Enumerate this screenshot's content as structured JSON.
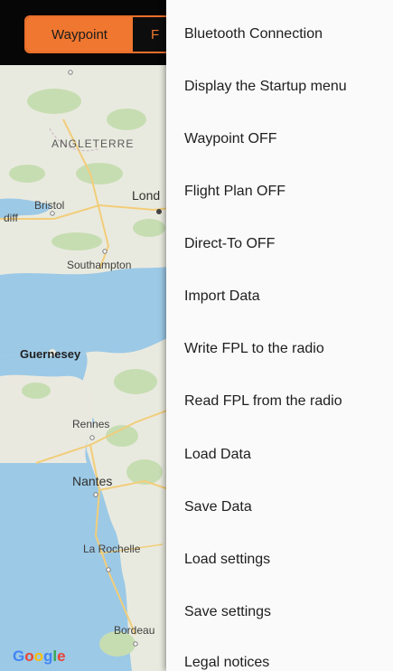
{
  "tabs": [
    {
      "label": "Waypoint"
    },
    {
      "label": "F"
    }
  ],
  "map": {
    "labels": {
      "angleterre": "ANGLETERRE",
      "bristol": "Bristol",
      "london": "Lond",
      "cardiff": "diff",
      "southampton": "Southampton",
      "guernesey": "Guernesey",
      "rennes": "Rennes",
      "nantes": "Nantes",
      "larochelle": "La Rochelle",
      "bordeaux": "Bordeau"
    },
    "attribution": [
      "G",
      "o",
      "o",
      "g",
      "l",
      "e"
    ],
    "colors": {
      "sea": "#9cc9e6",
      "land": "#e9eadf",
      "forest": "#c4dcb0",
      "road": "#f5cf7d"
    }
  },
  "menu": {
    "items": [
      {
        "label": "Bluetooth Connection"
      },
      {
        "label": "Display the Startup menu"
      },
      {
        "label": "Waypoint OFF"
      },
      {
        "label": "Flight Plan OFF"
      },
      {
        "label": "Direct-To OFF"
      },
      {
        "label": "Import Data"
      },
      {
        "label": "Write FPL to the radio"
      },
      {
        "label": "Read FPL from the radio"
      },
      {
        "label": "Load Data"
      },
      {
        "label": "Save Data"
      },
      {
        "label": "Load settings"
      },
      {
        "label": "Save settings"
      },
      {
        "label": "Legal notices"
      }
    ]
  }
}
